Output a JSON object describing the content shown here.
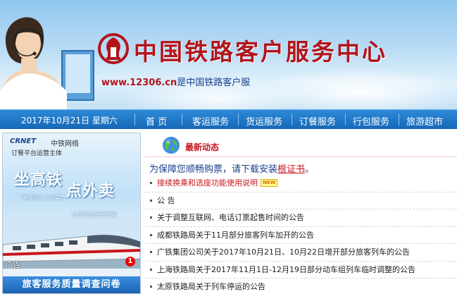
{
  "header": {
    "site_title": "中国铁路客户服务中心",
    "url": "www.12306.cn",
    "url_suffix": "是中国铁路客户服"
  },
  "nav": {
    "date": "2017年10月21日 星期六",
    "items": [
      "首 页",
      "客运服务",
      "货运服务",
      "订餐服务",
      "行包服务",
      "旅游超市"
    ]
  },
  "left_ad": {
    "brand_logo": "CRNET",
    "brand_name": "中铁网络",
    "subtitle": "订餐平台运营主体",
    "headline1": "坐高铁",
    "headline_small": "享用指尖上的美食",
    "headline2": "点外卖",
    "headline_small2": "让您的旅行更惬意",
    "label": "广告",
    "badge": "1",
    "bottom_banner": "旅客服务质量调查问卷"
  },
  "news": {
    "title": "最新动态",
    "notice_prefix": "为保障您顺畅购票，请下载安装",
    "notice_link": "根证书",
    "notice_suffix": "。",
    "new_badge": "NEW",
    "items": [
      "接续换乘和选座功能使用说明",
      "公 告",
      "关于调整互联网、电话订票起售时间的公告",
      "成都铁路局关于11月部分旅客列车加开的公告",
      "广铁集团公司关于2017年10月21日、10月22日增开部分旅客列车的公告",
      "上海铁路局关于2017年11月1日-12月19日部分动车组列车临时调整的公告",
      "太原铁路局关于列车停运的公告"
    ]
  },
  "colors": {
    "brand_red": "#b2141a",
    "nav_blue": "#1667b7",
    "link_blue": "#1a3f8c"
  }
}
